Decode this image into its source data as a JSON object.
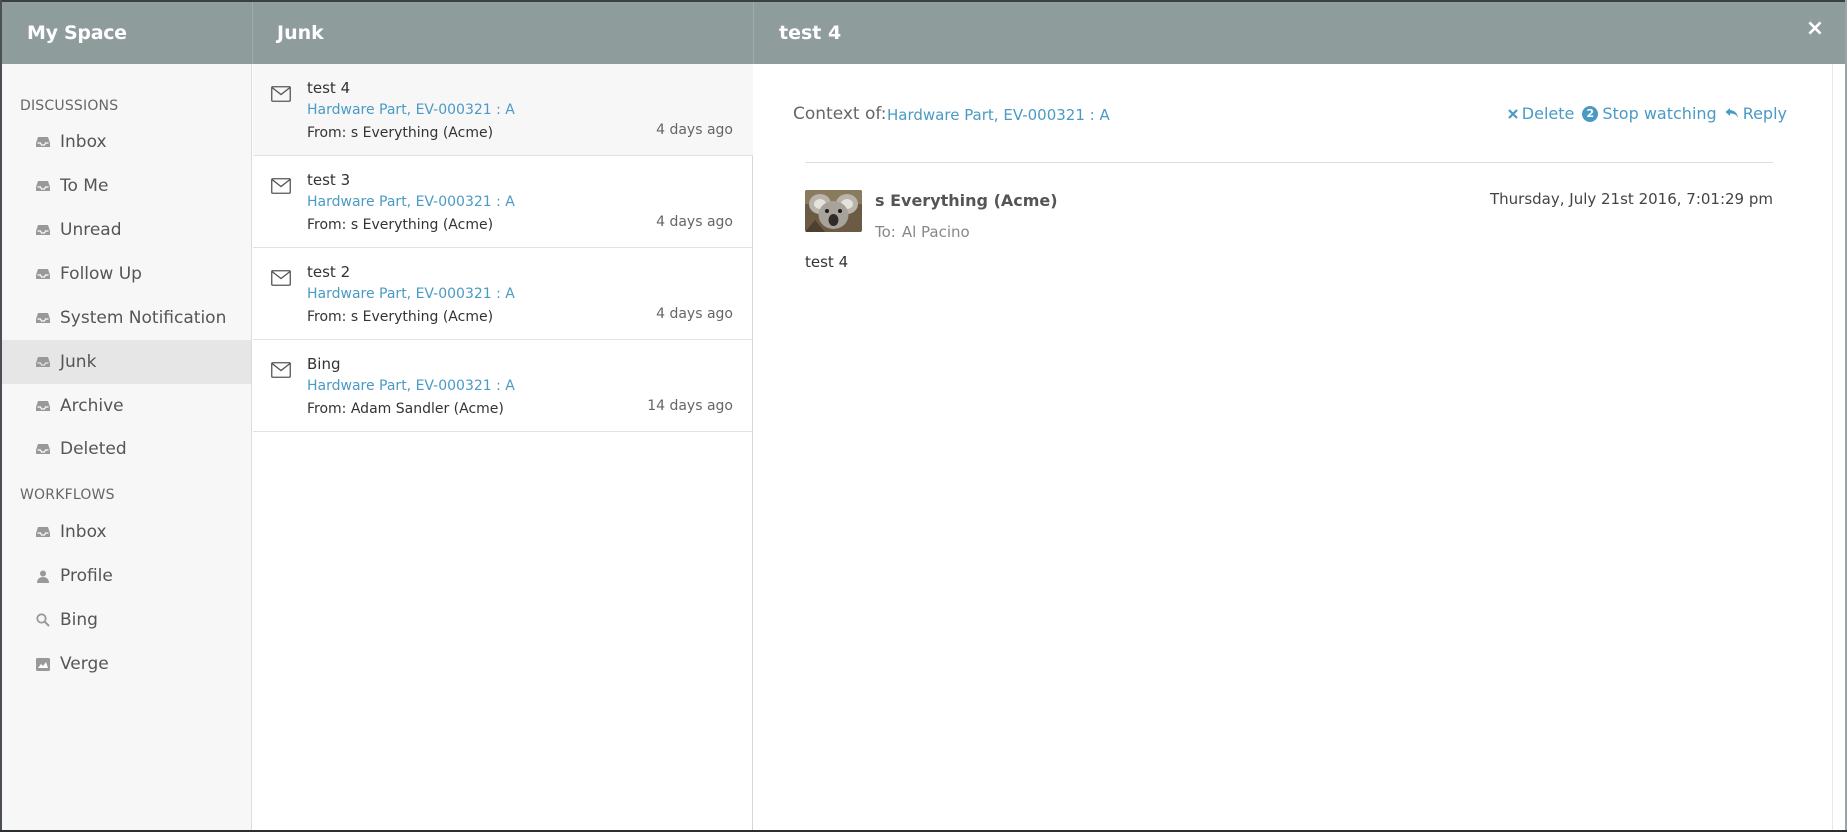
{
  "header": {
    "sidebar_title": "My Space",
    "list_title": "Junk",
    "detail_title": "test 4",
    "close_glyph": "×"
  },
  "sidebar": {
    "discussions_label": "DISCUSSIONS",
    "workflows_label": "WORKFLOWS",
    "discussions": [
      {
        "label": "Inbox",
        "icon": "inbox-icon"
      },
      {
        "label": "To Me",
        "icon": "inbox-icon"
      },
      {
        "label": "Unread",
        "icon": "inbox-icon"
      },
      {
        "label": "Follow Up",
        "icon": "inbox-icon"
      },
      {
        "label": "System Notification",
        "icon": "inbox-icon"
      },
      {
        "label": "Junk",
        "icon": "inbox-icon",
        "active": true
      },
      {
        "label": "Archive",
        "icon": "inbox-icon"
      },
      {
        "label": "Deleted",
        "icon": "inbox-icon"
      }
    ],
    "workflows": [
      {
        "label": "Inbox",
        "icon": "inbox-icon"
      },
      {
        "label": "Profile",
        "icon": "user-icon"
      },
      {
        "label": "Bing",
        "icon": "search-icon"
      },
      {
        "label": "Verge",
        "icon": "image-icon"
      }
    ]
  },
  "messages": [
    {
      "subject": "test 4",
      "context": "Hardware Part, EV-000321 : A",
      "from": "From: s Everything (Acme)",
      "time": "4 days ago",
      "active": true
    },
    {
      "subject": "test 3",
      "context": "Hardware Part, EV-000321 : A",
      "from": "From: s Everything (Acme)",
      "time": "4 days ago"
    },
    {
      "subject": "test 2",
      "context": "Hardware Part, EV-000321 : A",
      "from": "From: s Everything (Acme)",
      "time": "4 days ago"
    },
    {
      "subject": "Bing",
      "context": "Hardware Part, EV-000321 : A",
      "from": "From: Adam Sandler (Acme)",
      "time": "14 days ago"
    }
  ],
  "detail": {
    "context_label": "Context of:",
    "context_link": "Hardware Part, EV-000321 : A",
    "delete_label": "Delete",
    "watch_count": "2",
    "stop_watching_label": "Stop watching",
    "reply_label": "Reply",
    "sender": "s Everything (Acme)",
    "to_label": "To:",
    "to_name": "Al Pacino",
    "date": "Thursday, July 21st 2016, 7:01:29 pm",
    "body": "test 4"
  },
  "colors": {
    "header_bg": "#8e9c9c",
    "link": "#4a9ac4",
    "sidebar_bg": "#f7f7f7",
    "active_bg": "#e6e6e6"
  }
}
